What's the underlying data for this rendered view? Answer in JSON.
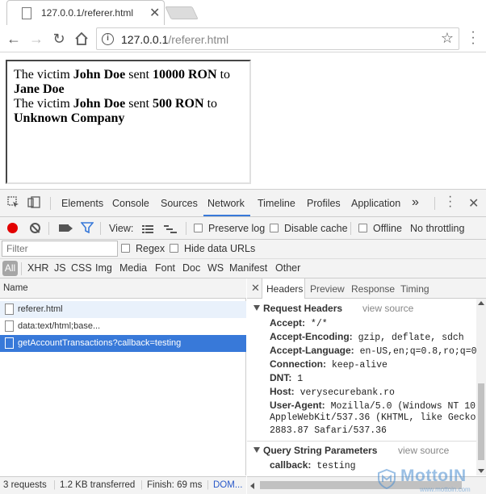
{
  "browser": {
    "tab_title": "127.0.0.1/referer.html",
    "url_host": "127.0.0.1",
    "url_path": "/referer.html"
  },
  "page": {
    "line1": {
      "pre": "The victim ",
      "name": "John Doe",
      "mid": " sent ",
      "amount": "10000 RON",
      "post": " to",
      "recipient": "Jane Doe"
    },
    "line2": {
      "pre": "The victim ",
      "name": "John Doe",
      "mid": " sent ",
      "amount": "500 RON",
      "post": " to",
      "recipient": "Unknown Company"
    }
  },
  "devtools": {
    "tabs": [
      "Elements",
      "Console",
      "Sources",
      "Network",
      "Timeline",
      "Profiles",
      "Application"
    ],
    "active_tab": "Network",
    "more_tabs": "»",
    "controls": {
      "view_label": "View:",
      "preserve_log": "Preserve log",
      "disable_cache": "Disable cache",
      "offline": "Offline",
      "throttling": "No throttling"
    },
    "filter": {
      "placeholder": "Filter",
      "regex": "Regex",
      "hide_data_urls": "Hide data URLs"
    },
    "types": [
      "All",
      "XHR",
      "JS",
      "CSS",
      "Img",
      "Media",
      "Font",
      "Doc",
      "WS",
      "Manifest",
      "Other"
    ],
    "requests_header": "Name",
    "requests": [
      {
        "name": "referer.html",
        "state": "highlighted"
      },
      {
        "name": "data:text/html;base...",
        "state": "normal"
      },
      {
        "name": "getAccountTransactions?callback=testing",
        "state": "selected"
      }
    ],
    "detail_tabs": [
      "Headers",
      "Preview",
      "Response",
      "Timing"
    ],
    "active_detail_tab": "Headers",
    "request_headers": {
      "title": "Request Headers",
      "view_source": "view source",
      "items": [
        {
          "k": "Accept:",
          "v": " */*"
        },
        {
          "k": "Accept-Encoding:",
          "v": " gzip, deflate, sdch"
        },
        {
          "k": "Accept-Language:",
          "v": " en-US,en;q=0.8,ro;q=0."
        },
        {
          "k": "Connection:",
          "v": " keep-alive"
        },
        {
          "k": "DNT:",
          "v": " 1"
        },
        {
          "k": "Host:",
          "v": " verysecurebank.ro"
        },
        {
          "k": "User-Agent:",
          "v": " Mozilla/5.0 (Windows NT 10."
        }
      ],
      "user_agent_cont": [
        " AppleWebKit/537.36 (KHTML, like Gecko",
        "2883.87 Safari/537.36"
      ]
    },
    "query_params": {
      "title": "Query String Parameters",
      "view_source": "view source",
      "items": [
        {
          "k": "callback:",
          "v": " testing"
        }
      ]
    },
    "status": {
      "requests": "3 requests",
      "transferred": "1.2 KB transferred",
      "finish": "Finish: 69 ms",
      "dom": "DOM..."
    }
  },
  "watermark": {
    "brand": "MottoIN",
    "site": "www.mottoin.com"
  }
}
